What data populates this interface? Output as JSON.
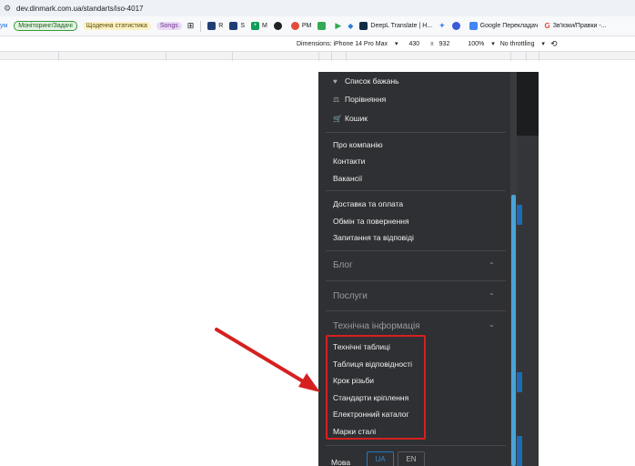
{
  "browser": {
    "url": "dev.dinmark.com.ua/standarts/iso-4017",
    "bookmarks": [
      {
        "label": "ум",
        "kind": "text"
      },
      {
        "label": "Моніторинг/Задачі",
        "kind": "pill-green"
      },
      {
        "label": "Щоденна статистика",
        "kind": "pill-yellow"
      },
      {
        "label": "Songs",
        "kind": "pill-purple"
      },
      {
        "label": "R",
        "kind": "icon",
        "color": "#1f3f74"
      },
      {
        "label": "S",
        "kind": "icon",
        "color": "#1f3f74"
      },
      {
        "label": "M",
        "kind": "icon",
        "color": "#0f9d58"
      },
      {
        "label": "PM",
        "kind": "icon",
        "color": "#e24a3b"
      },
      {
        "label": "DeepL Translate | H...",
        "kind": "icon",
        "color": "#0f2b46"
      },
      {
        "label": "Google Перекладач",
        "kind": "icon",
        "color": "#4285f4"
      },
      {
        "label": "Зв'язки/Правки -...",
        "kind": "icon",
        "color": "#ea4335"
      }
    ]
  },
  "devtools": {
    "dimensions_label": "Dimensions: iPhone 14 Pro Max",
    "width": "430",
    "times": "x",
    "height": "932",
    "zoom": "100%",
    "throttling": "No throttling"
  },
  "menu": {
    "top_items": [
      {
        "label": "Список бажань",
        "icon": "heart-icon"
      },
      {
        "label": "Порівняння",
        "icon": "compare-icon"
      },
      {
        "label": "Кошик",
        "icon": "cart-icon"
      }
    ],
    "company_items": [
      "Про компанію",
      "Контакти",
      "Вакансії"
    ],
    "service_items": [
      "Доставка та оплата",
      "Обмін та повернення",
      "Запитання та відповіді"
    ],
    "sections": [
      {
        "label": "Блог",
        "state": "collapsed"
      },
      {
        "label": "Послуги",
        "state": "collapsed"
      },
      {
        "label": "Технічна інформація",
        "state": "expanded"
      }
    ],
    "tech_items": [
      "Технічні таблиці",
      "Таблиця відповідності",
      "Крок різьби",
      "Стандарти кріплення",
      "Електронний каталог",
      "Марки сталі"
    ],
    "language_label": "Мова",
    "languages": [
      {
        "label": "UA",
        "active": true
      },
      {
        "label": "EN",
        "active": false
      }
    ]
  },
  "annotation": {
    "color": "#d62020"
  }
}
